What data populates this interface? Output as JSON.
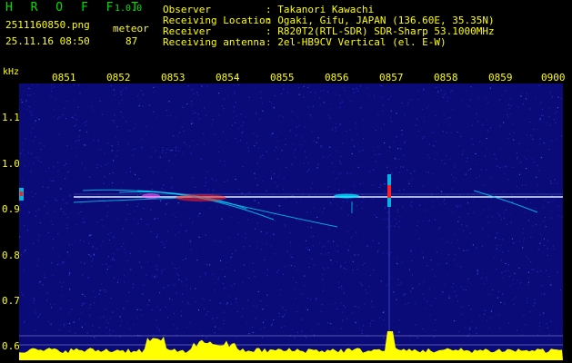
{
  "header": {
    "app_name": "H R O F F T",
    "version": "1.0.0",
    "file_name": "2511160850.png",
    "detection_label": "meteor",
    "datetime": "25.11.16 08:50",
    "detection_count": "87",
    "fields": [
      {
        "label": "Observer",
        "value": ": Takanori Kawachi"
      },
      {
        "label": "Receiving Location",
        "value": ": Ogaki, Gifu, JAPAN (136.60E, 35.35N)"
      },
      {
        "label": "Receiver",
        "value": ": R820T2(RTL-SDR) SDR-Sharp 53.1000MHz"
      },
      {
        "label": "Receiving antenna",
        "value": ": 2el-HB9CV Vertical (el. E-W)"
      }
    ]
  },
  "axes": {
    "y_unit": "kHz",
    "y_ticks": [
      "1.1",
      "1.0",
      "0.9",
      "0.8",
      "0.7",
      "0.6"
    ],
    "x_ticks": [
      "0851",
      "0852",
      "0853",
      "0854",
      "0855",
      "0856",
      "0857",
      "0858",
      "0859",
      "0900"
    ]
  },
  "colors": {
    "background": "#0a0a78",
    "noise": "#2f2fd0",
    "carrier": "#e0f0ff",
    "echo": "#00e0ff",
    "hot": "#ff2020",
    "level": "#ffff00",
    "text": "#ffff00"
  }
}
